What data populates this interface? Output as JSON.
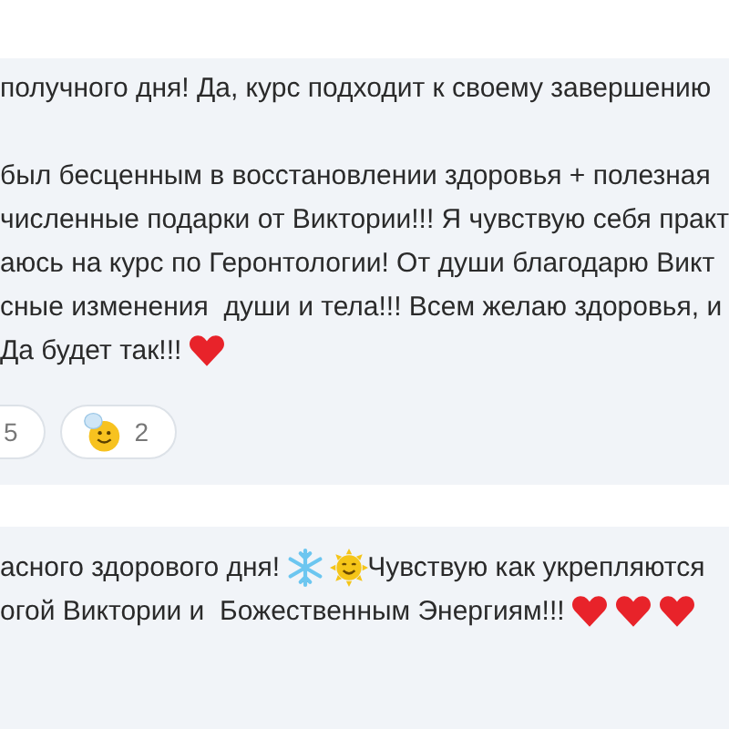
{
  "comments": [
    {
      "paragraphs": [
        [
          [
            {
              "kind": "text",
              "text": "получного дня! Да, курс подходит к своему завершению"
            }
          ]
        ],
        [
          [
            {
              "kind": "text",
              "text": "был бесценным в восстановлении здоровья + полезная"
            }
          ],
          [
            {
              "kind": "text",
              "text": "численные подарки от Виктории!!! Я чувствую себя практ"
            }
          ],
          [
            {
              "kind": "text",
              "text": "аюсь на курс по Геронтологии! От души благодарю Викт"
            }
          ],
          [
            {
              "kind": "text",
              "text": "сные изменения  души и тела!!! Всем желаю здоровья, и"
            }
          ],
          [
            {
              "kind": "text",
              "text": "Да будет так!!!"
            },
            {
              "kind": "heart"
            }
          ]
        ]
      ],
      "reactions": [
        {
          "count": "5"
        },
        {
          "kind": "smiley",
          "count": "2"
        }
      ]
    },
    {
      "paragraphs": [
        [
          [
            {
              "kind": "text",
              "text": "асного здорового дня!"
            },
            {
              "kind": "snowflake"
            },
            {
              "kind": "sun"
            },
            {
              "kind": "text",
              "text": "Чувствую как укрепляются"
            }
          ],
          [
            {
              "kind": "text",
              "text": "огой Виктории и  Божественным Энергиям!!!"
            },
            {
              "kind": "heart"
            },
            {
              "kind": "heart"
            },
            {
              "kind": "heart"
            }
          ]
        ]
      ]
    }
  ]
}
